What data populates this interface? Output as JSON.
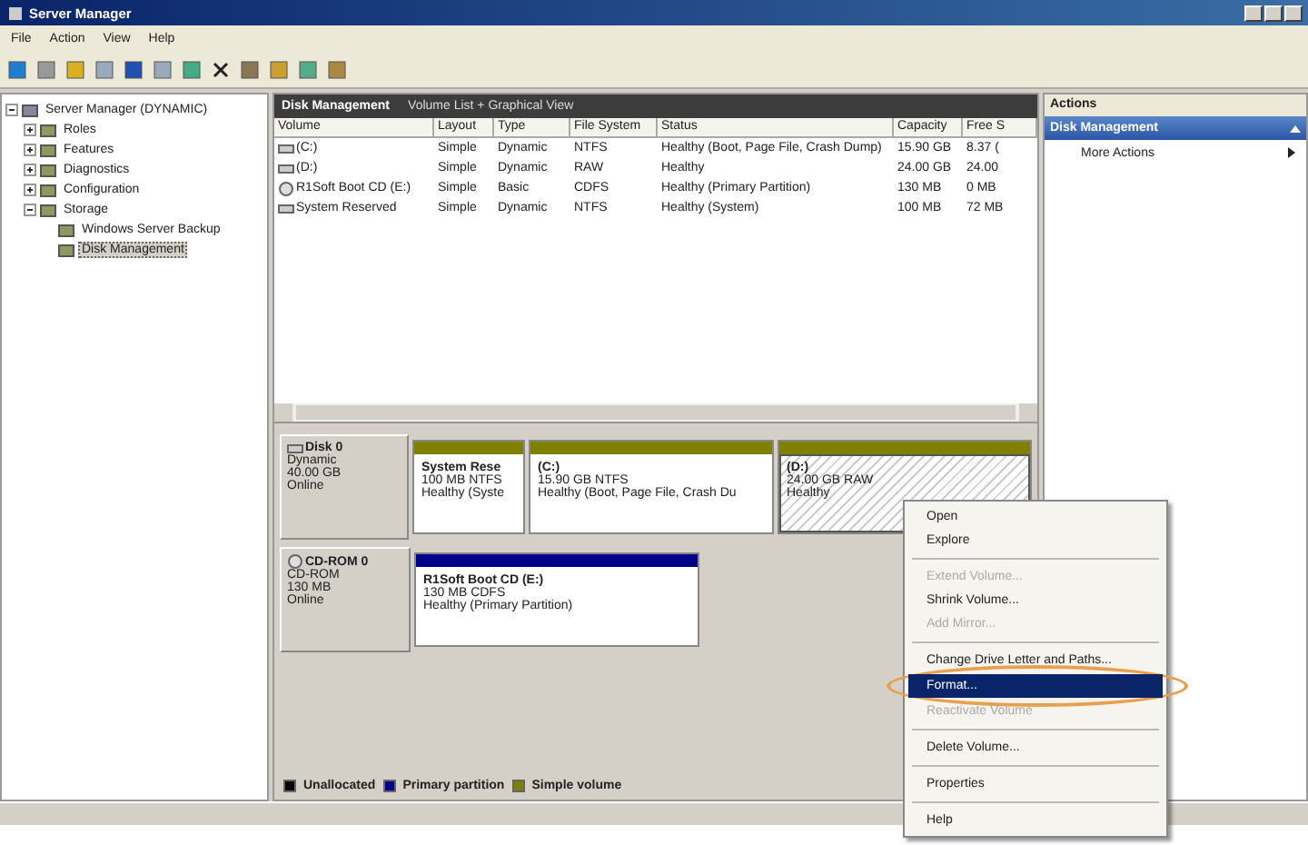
{
  "window": {
    "title": "Server Manager"
  },
  "menu_bar": [
    "File",
    "Action",
    "View",
    "Help"
  ],
  "tree": [
    {
      "label": "Server Manager (DYNAMIC)",
      "expanded": true,
      "selected": false,
      "children": [
        {
          "label": "Roles",
          "expanded": false,
          "selected": false
        },
        {
          "label": "Features",
          "expanded": false,
          "selected": false
        },
        {
          "label": "Diagnostics",
          "expanded": false,
          "selected": false
        },
        {
          "label": "Configuration",
          "expanded": false,
          "selected": false
        },
        {
          "label": "Storage",
          "expanded": true,
          "selected": false,
          "children": [
            {
              "label": "Windows Server Backup",
              "selected": false
            },
            {
              "label": "Disk Management",
              "selected": true
            }
          ]
        }
      ]
    }
  ],
  "center": {
    "title": "Disk Management",
    "subtitle": "Volume List + Graphical View",
    "columns": [
      "Volume",
      "Layout",
      "Type",
      "File System",
      "Status",
      "Capacity",
      "Free S"
    ],
    "rows": [
      {
        "kind": "disk",
        "cells": [
          "(C:)",
          "Simple",
          "Dynamic",
          "NTFS",
          "Healthy (Boot, Page File, Crash Dump)",
          "15.90 GB",
          "8.37 ("
        ]
      },
      {
        "kind": "disk",
        "cells": [
          "(D:)",
          "Simple",
          "Dynamic",
          "RAW",
          "Healthy",
          "24.00 GB",
          "24.00"
        ]
      },
      {
        "kind": "cd",
        "cells": [
          "R1Soft Boot CD (E:)",
          "Simple",
          "Basic",
          "CDFS",
          "Healthy (Primary Partition)",
          "130 MB",
          "0 MB"
        ]
      },
      {
        "kind": "disk",
        "cells": [
          "System Reserved",
          "Simple",
          "Dynamic",
          "NTFS",
          "Healthy (System)",
          "100 MB",
          "72 MB"
        ]
      }
    ],
    "disks": [
      {
        "kind": "disk",
        "name": "Disk 0",
        "lines": [
          "Dynamic",
          "40.00 GB",
          "Online"
        ],
        "partitions": [
          {
            "name": "System Rese",
            "size": "100 MB NTFS",
            "status": "Healthy (Syste",
            "color": "#808000",
            "selected": false
          },
          {
            "name": "(C:)",
            "size": "15.90 GB NTFS",
            "status": "Healthy (Boot, Page File, Crash Du",
            "color": "#808000",
            "selected": false
          },
          {
            "name": "(D:)",
            "size": "24.00 GB RAW",
            "status": "Healthy",
            "color": "#808000",
            "selected": true
          }
        ]
      },
      {
        "kind": "cd",
        "name": "CD-ROM 0",
        "lines": [
          "CD-ROM",
          "130 MB",
          "Online"
        ],
        "partitions": [
          {
            "name": "R1Soft Boot CD  (E:)",
            "size": "130 MB CDFS",
            "status": "Healthy (Primary Partition)",
            "color": "#00008b",
            "selected": false
          }
        ]
      }
    ],
    "legend": [
      {
        "label": "Unallocated",
        "color": "#000000"
      },
      {
        "label": "Primary partition",
        "color": "#00008b"
      },
      {
        "label": "Simple volume",
        "color": "#808000"
      }
    ]
  },
  "actions": {
    "title": "Actions",
    "section": "Disk Management",
    "items": [
      "More Actions"
    ]
  },
  "context_menu": {
    "groups": [
      [
        {
          "label": "Open",
          "disabled": false,
          "selected": false
        },
        {
          "label": "Explore",
          "disabled": false,
          "selected": false
        }
      ],
      [
        {
          "label": "Extend Volume...",
          "disabled": true,
          "selected": false
        },
        {
          "label": "Shrink Volume...",
          "disabled": false,
          "selected": false
        },
        {
          "label": "Add Mirror...",
          "disabled": true,
          "selected": false
        }
      ],
      [
        {
          "label": "Change Drive Letter and Paths...",
          "disabled": false,
          "selected": false
        },
        {
          "label": "Format...",
          "disabled": false,
          "selected": true
        },
        {
          "label": "Reactivate Volume",
          "disabled": true,
          "selected": false
        }
      ],
      [
        {
          "label": "Delete Volume...",
          "disabled": false,
          "selected": false
        }
      ],
      [
        {
          "label": "Properties",
          "disabled": false,
          "selected": false
        }
      ],
      [
        {
          "label": "Help",
          "disabled": false,
          "selected": false
        }
      ]
    ]
  }
}
